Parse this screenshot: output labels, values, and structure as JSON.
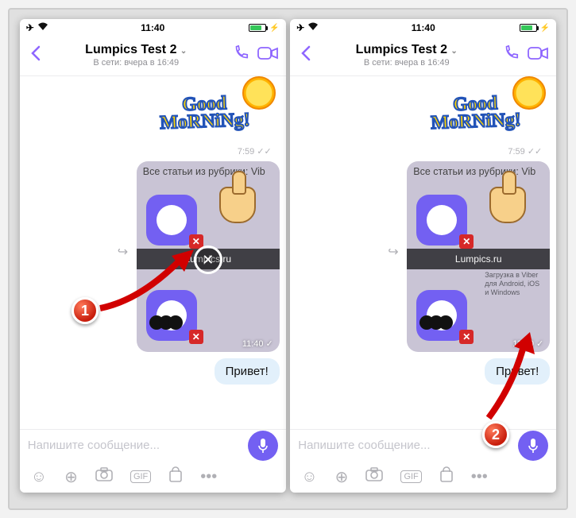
{
  "statusbar": {
    "time": "11:40"
  },
  "header": {
    "title": "Lumpics Test 2",
    "subtitle": "В сети: вчера в 16:49"
  },
  "chat": {
    "sticker_text_line1": "Good",
    "sticker_text_line2": "MoRNiNg!",
    "sticker_time": "7:59",
    "image_bubble": {
      "caption": "Все статьи из рубрики: Vib",
      "url": "Lumpics.ru",
      "subtext": "Загрузка в Viber для Android, iOS и Windows",
      "time": "11:40"
    },
    "text_bubble": "Привет!"
  },
  "inputbar": {
    "placeholder": "Напишите сообщение..."
  },
  "callouts": {
    "one": "1",
    "two": "2"
  }
}
